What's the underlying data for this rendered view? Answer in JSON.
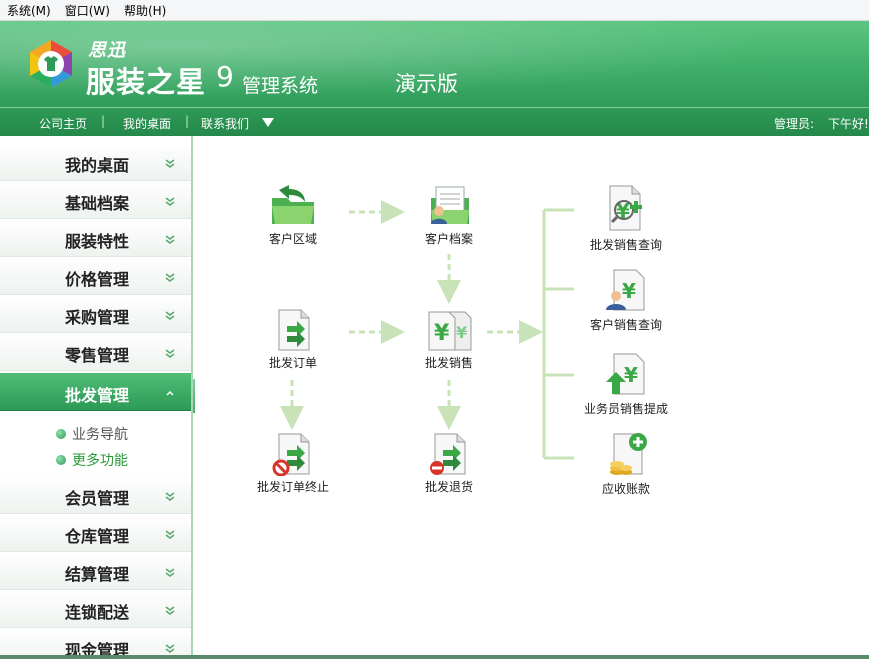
{
  "menu": [
    "系统(M)",
    "窗口(W)",
    "帮助(H)"
  ],
  "banner": {
    "brand_small": "思迅",
    "brand_name": "服装之星",
    "version": "9",
    "system": "管理系统",
    "edition": "演示版"
  },
  "nav": {
    "links": [
      "公司主页",
      "我的桌面",
      "联系我们"
    ],
    "separator": "|",
    "admin": "管理员:",
    "greeting": "下午好!"
  },
  "sidebar": {
    "items": [
      {
        "label": "我的桌面"
      },
      {
        "label": "基础档案"
      },
      {
        "label": "服装特性"
      },
      {
        "label": "价格管理"
      },
      {
        "label": "采购管理"
      },
      {
        "label": "零售管理"
      },
      {
        "label": "批发管理",
        "active": true
      },
      {
        "label": "会员管理"
      },
      {
        "label": "仓库管理"
      },
      {
        "label": "结算管理"
      },
      {
        "label": "连锁配送"
      },
      {
        "label": "现金管理"
      }
    ],
    "sub_items": [
      {
        "label": "业务导航"
      },
      {
        "label": "更多功能",
        "link": true
      }
    ]
  },
  "flow": {
    "nodes": [
      {
        "label": "客户区域",
        "icon": "folder-return-icon"
      },
      {
        "label": "客户档案",
        "icon": "customer-file-icon"
      },
      {
        "label": "批发订单",
        "icon": "doc-arrow-icon"
      },
      {
        "label": "批发销售",
        "icon": "yen-docs-icon"
      },
      {
        "label": "批发订单终止",
        "icon": "doc-stop-icon"
      },
      {
        "label": "批发退货",
        "icon": "doc-return-icon"
      },
      {
        "label": "批发销售查询",
        "icon": "doc-search-icon"
      },
      {
        "label": "客户销售查询",
        "icon": "customer-yen-icon"
      },
      {
        "label": "业务员销售提成",
        "icon": "commission-icon"
      },
      {
        "label": "应收账款",
        "icon": "receivable-icon"
      }
    ]
  },
  "colors": {
    "brand_green": "#3fae69",
    "nav_green": "#2e9a56",
    "flow_line": "#c9e3b8",
    "link_green": "#2a9a3a"
  }
}
